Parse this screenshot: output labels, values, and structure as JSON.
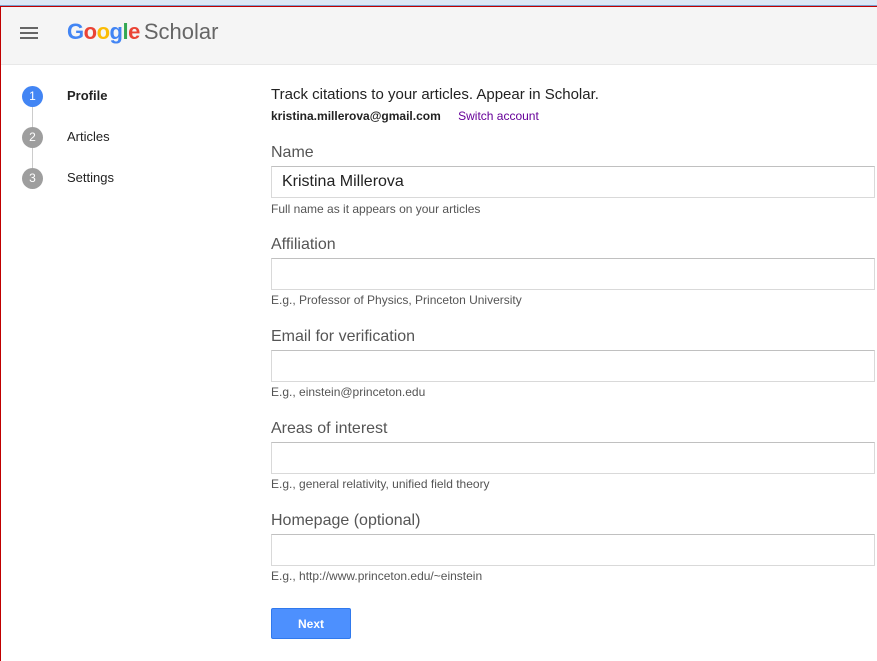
{
  "header": {
    "logo_letters": [
      "G",
      "o",
      "o",
      "g",
      "l",
      "e"
    ],
    "logo_suffix": "Scholar",
    "menu_icon": "hamburger-menu-icon"
  },
  "steps": [
    {
      "number": "1",
      "label": "Profile",
      "state": "active",
      "color": "#4285f4"
    },
    {
      "number": "2",
      "label": "Articles",
      "state": "inactive",
      "color": "#9e9e9e"
    },
    {
      "number": "3",
      "label": "Settings",
      "state": "inactive",
      "color": "#9e9e9e"
    }
  ],
  "intro": "Track citations to your articles. Appear in Scholar.",
  "account": {
    "email": "kristina.millerova@gmail.com",
    "switch_label": "Switch account"
  },
  "fields": [
    {
      "label": "Name",
      "value": "Kristina Millerova",
      "help": "Full name as it appears on your articles"
    },
    {
      "label": "Affiliation",
      "value": "",
      "help": "E.g., Professor of Physics, Princeton University"
    },
    {
      "label": "Email for verification",
      "value": "",
      "help": "E.g., einstein@princeton.edu"
    },
    {
      "label": "Areas of interest",
      "value": "",
      "help": "E.g., general relativity, unified field theory"
    },
    {
      "label": "Homepage (optional)",
      "value": "",
      "help": "E.g., http://www.princeton.edu/~einstein"
    }
  ],
  "next_label": "Next",
  "colors": {
    "accent_blue": "#4d90fe",
    "link_purple": "#660099",
    "header_bg": "#f5f5f5"
  }
}
